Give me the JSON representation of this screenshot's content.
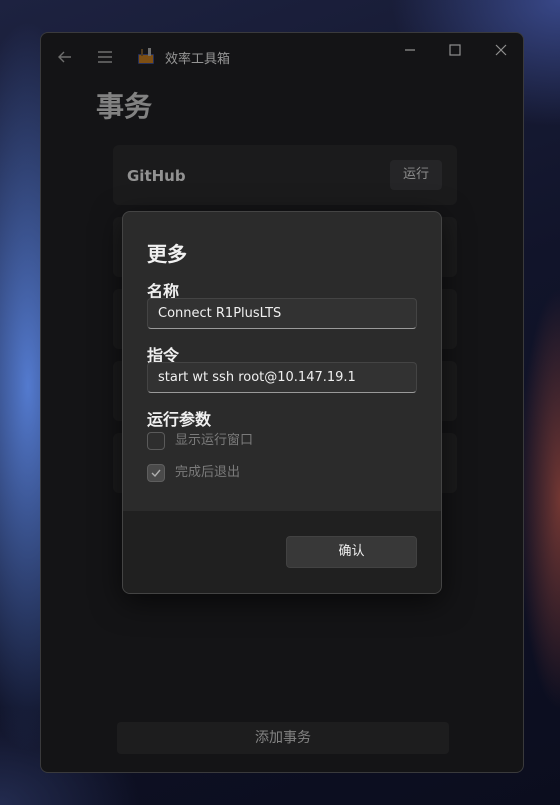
{
  "titlebar": {
    "app_title": "效率工具箱",
    "back_icon": "back-arrow-icon",
    "menu_icon": "hamburger-menu-icon",
    "minimize_icon": "minimize-icon",
    "maximize_icon": "maximize-icon",
    "close_icon": "close-icon"
  },
  "page": {
    "title": "事务",
    "tasks": [
      {
        "name": "GitHub",
        "run_label": "运行"
      }
    ],
    "add_label": "添加事务"
  },
  "dialog": {
    "title": "更多",
    "name_label": "名称",
    "name_value": "Connect R1PlusLTS",
    "command_label": "指令",
    "command_value": "start wt ssh root@10.147.19.1",
    "params_label": "运行参数",
    "options": [
      {
        "label": "显示运行窗口",
        "checked": false
      },
      {
        "label": "完成后退出",
        "checked": true
      }
    ],
    "confirm_label": "确认"
  }
}
